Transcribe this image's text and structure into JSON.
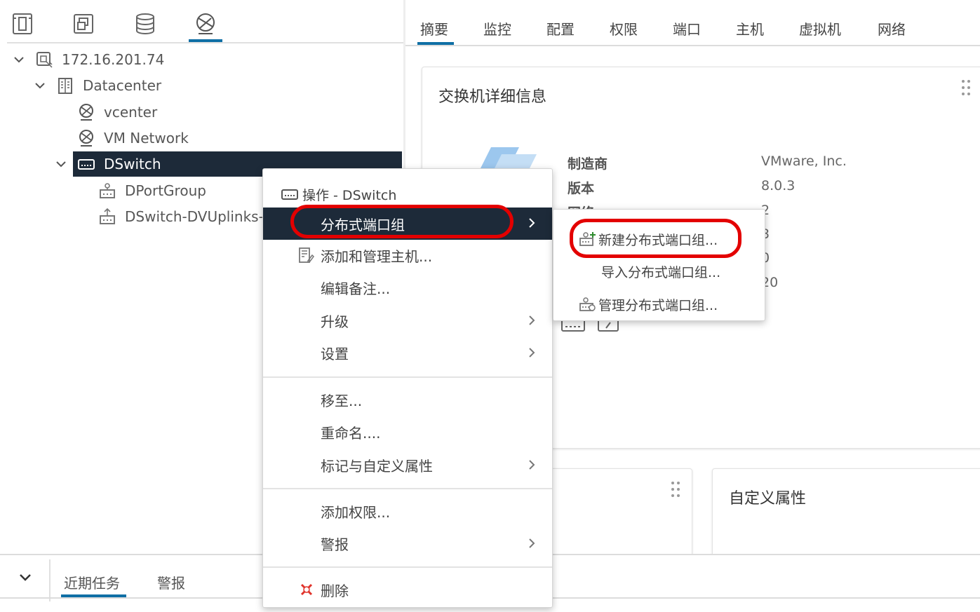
{
  "nav": {
    "icons": [
      "hosts-clusters-icon",
      "vms-templates-icon",
      "storage-icon",
      "networking-icon"
    ],
    "active_color": "#0f6fa5"
  },
  "tree": {
    "vcenter_ip": "172.16.201.74",
    "datacenter": "Datacenter",
    "net_vcenter": "vcenter",
    "net_vm": "VM Network",
    "dswitch": "DSwitch",
    "dportgroup": "DPortGroup",
    "uplinks": "DSwitch-DVUplinks-"
  },
  "tabs": [
    "摘要",
    "监控",
    "配置",
    "权限",
    "端口",
    "主机",
    "虚拟机",
    "网络"
  ],
  "switch_card": {
    "title": "交换机详细信息",
    "rows": [
      {
        "key": "制造商",
        "value": "VMware, Inc."
      },
      {
        "key": "版本",
        "value": "8.0.3"
      },
      {
        "key": "网络",
        "value": "2"
      }
    ],
    "partial_values": [
      "3",
      "0",
      "20"
    ]
  },
  "custom_card": {
    "title": "自定义属性"
  },
  "bottom": {
    "tabs": [
      "近期任务",
      "警报"
    ]
  },
  "menu": {
    "header": "操作 - DSwitch",
    "items": {
      "dpg": "分布式端口组",
      "add_host": "添加和管理主机...",
      "edit_notes": "编辑备注...",
      "upgrade": "升级",
      "settings": "设置",
      "move": "移至...",
      "rename": "重命名....",
      "tags": "标记与自定义属性",
      "add_perm": "添加权限...",
      "alarms": "警报",
      "delete": "删除"
    }
  },
  "submenu": {
    "new_dpg": "新建分布式端口组...",
    "import_dpg": "导入分布式端口组...",
    "manage_dpg": "管理分布式端口组..."
  },
  "colors": {
    "selection": "#1d2a39",
    "highlight": "#e30000",
    "accent": "#0f6fa5"
  }
}
